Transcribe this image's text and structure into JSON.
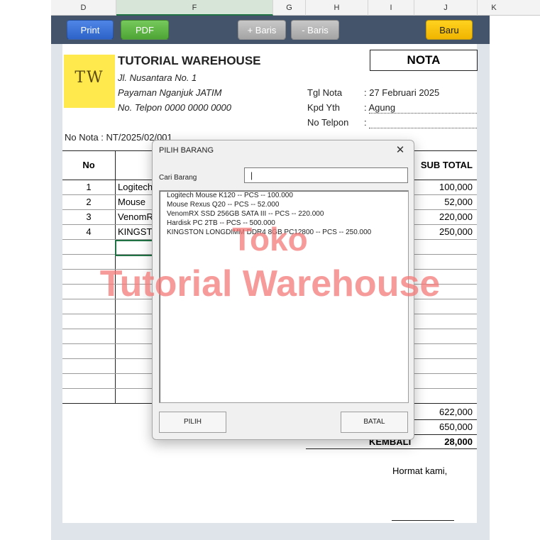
{
  "columns": [
    "D",
    "F",
    "G",
    "H",
    "I",
    "J",
    "K"
  ],
  "toolbar": {
    "print": "Print",
    "pdf": "PDF",
    "add_row": "+ Baris",
    "del_row": "- Baris",
    "new": "Baru"
  },
  "invoice": {
    "company": "TUTORIAL WAREHOUSE",
    "logo_text": "TW",
    "address1": "Jl. Nusantara No. 1",
    "address2": "Payaman Nganjuk JATIM",
    "phone": "No. Telpon 0000 0000 0000",
    "doc_title": "NOTA",
    "date_label": "Tgl Nota",
    "date_value": ": 27 Februari 2025",
    "to_label": "Kpd Yth",
    "to_value": ": Agung",
    "tel_label": "No Telpon",
    "tel_value": ":",
    "nota_no": "No Nota   : NT/2025/02/001",
    "col_no": "No",
    "col_subtotal": "SUB TOTAL",
    "rows": [
      {
        "no": "1",
        "name": "Logitech",
        "subtotal": "100,000"
      },
      {
        "no": "2",
        "name": "Mouse",
        "subtotal": "52,000"
      },
      {
        "no": "3",
        "name": "VenomR",
        "subtotal": "220,000"
      },
      {
        "no": "4",
        "name": "KINGST",
        "subtotal": "250,000"
      }
    ],
    "total": "622,000",
    "paid": "650,000",
    "change_label": "KEMBALI",
    "change_value": "28,000",
    "regards": "Hormat kami,"
  },
  "watermark": {
    "line1": "Toko",
    "line2": "Tutorial Warehouse"
  },
  "dialog": {
    "title": "PILIH BARANG",
    "search_label": "Cari Barang",
    "search_value": "|",
    "items": [
      "Logitech Mouse K120 -- PCS -- 100.000",
      "Mouse Rexus Q20 -- PCS -- 52.000",
      "VenomRX SSD 256GB SATA III -- PCS -- 220.000",
      "Hardisk PC 2TB -- PCS -- 500.000",
      "KINGSTON LONGDIMM DDR4 8GB PC12800 -- PCS -- 250.000"
    ],
    "ok": "PILIH",
    "cancel": "BATAL"
  },
  "colors": {
    "toolbar": "#44546a",
    "print": "#2d63c8",
    "pdf": "#4ea535",
    "new": "#f0b400",
    "logo": "#ffe94d",
    "watermark": "#f47878"
  }
}
